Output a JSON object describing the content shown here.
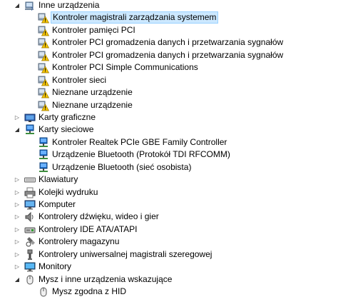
{
  "tree": [
    {
      "level": 0,
      "expanded": true,
      "icon": "unknown-devices-icon",
      "label": "Inne urządzenia"
    },
    {
      "level": 1,
      "icon": "warning-device-icon",
      "label": "Kontroler magistrali zarządzania systemem",
      "selected": true
    },
    {
      "level": 1,
      "icon": "warning-device-icon",
      "label": "Kontroler pamięci PCI"
    },
    {
      "level": 1,
      "icon": "warning-device-icon",
      "label": "Kontroler PCI gromadzenia danych i przetwarzania sygnałów"
    },
    {
      "level": 1,
      "icon": "warning-device-icon",
      "label": "Kontroler PCI gromadzenia danych i przetwarzania sygnałów"
    },
    {
      "level": 1,
      "icon": "warning-device-icon",
      "label": "Kontroler PCI Simple Communications"
    },
    {
      "level": 1,
      "icon": "warning-device-icon",
      "label": "Kontroler sieci"
    },
    {
      "level": 1,
      "icon": "warning-device-icon",
      "label": "Nieznane urządzenie"
    },
    {
      "level": 1,
      "icon": "warning-device-icon",
      "label": "Nieznane urządzenie"
    },
    {
      "level": 0,
      "expanded": false,
      "icon": "display-adapter-icon",
      "label": "Karty graficzne"
    },
    {
      "level": 0,
      "expanded": true,
      "icon": "network-adapter-icon",
      "label": "Karty sieciowe"
    },
    {
      "level": 1,
      "icon": "network-adapter-icon",
      "label": "Kontroler Realtek PCIe GBE Family Controller"
    },
    {
      "level": 1,
      "icon": "network-adapter-icon",
      "label": "Urządzenie Bluetooth (Protokół TDI RFCOMM)"
    },
    {
      "level": 1,
      "icon": "network-adapter-icon",
      "label": "Urządzenie Bluetooth (sieć osobista)"
    },
    {
      "level": 0,
      "expanded": false,
      "icon": "keyboard-icon",
      "label": "Klawiatury"
    },
    {
      "level": 0,
      "expanded": false,
      "icon": "print-queue-icon",
      "label": "Kolejki wydruku"
    },
    {
      "level": 0,
      "expanded": false,
      "icon": "computer-icon",
      "label": "Komputer"
    },
    {
      "level": 0,
      "expanded": false,
      "icon": "speaker-icon",
      "label": "Kontrolery dźwięku, wideo i gier"
    },
    {
      "level": 0,
      "expanded": false,
      "icon": "ide-controller-icon",
      "label": "Kontrolery IDE ATA/ATAPI"
    },
    {
      "level": 0,
      "expanded": false,
      "icon": "storage-controller-icon",
      "label": "Kontrolery magazynu"
    },
    {
      "level": 0,
      "expanded": false,
      "icon": "usb-icon",
      "label": "Kontrolery uniwersalnej magistrali szeregowej"
    },
    {
      "level": 0,
      "expanded": false,
      "icon": "monitor-icon",
      "label": "Monitory"
    },
    {
      "level": 0,
      "expanded": true,
      "icon": "mouse-icon",
      "label": "Mysz i inne urządzenia wskazujące"
    },
    {
      "level": 1,
      "icon": "mouse-icon",
      "label": "Mysz zgodna z HID"
    }
  ],
  "colors": {
    "selection_bg": "#cce8ff",
    "selection_border": "#99d1ff",
    "warning_yellow": "#f2c200",
    "network_blue": "#1f6fc9",
    "monitor_green": "#3a9a3a"
  }
}
